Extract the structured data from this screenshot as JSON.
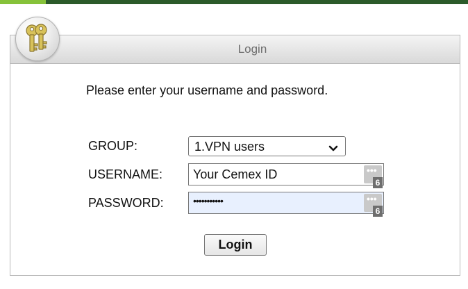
{
  "panel": {
    "title": "Login",
    "prompt": "Please enter your username and password."
  },
  "form": {
    "group_label": "GROUP:",
    "group_value": "1.VPN users",
    "username_label": "USERNAME:",
    "username_value": "Your Cemex ID",
    "password_label": "PASSWORD:",
    "password_masked": "•••••••••••",
    "extension_badge_count": "6",
    "extension_dots": "•••"
  },
  "button": {
    "login_label": "Login"
  },
  "colors": {
    "topbar": "#2b5a2a",
    "topbar_accent": "#86c23a",
    "password_field_bg": "#e8f0fe"
  },
  "icons": {
    "panel_icon": "keys-icon",
    "select_icon": "chevron-down-icon"
  }
}
